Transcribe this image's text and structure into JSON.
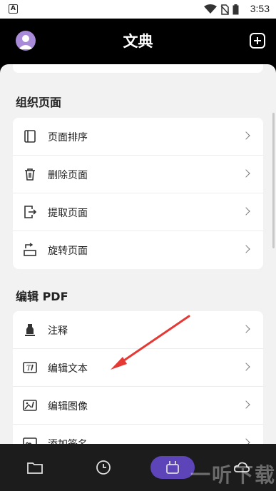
{
  "status_bar": {
    "time": "3:53",
    "notification_icon_letter": "A"
  },
  "header": {
    "title": "文典"
  },
  "sections": [
    {
      "title": "组织页面",
      "items": [
        {
          "label": "页面排序",
          "icon": "page-order-icon"
        },
        {
          "label": "删除页面",
          "icon": "trash-icon"
        },
        {
          "label": "提取页面",
          "icon": "extract-page-icon"
        },
        {
          "label": "旋转页面",
          "icon": "rotate-page-icon"
        }
      ]
    },
    {
      "title": "编辑 PDF",
      "items": [
        {
          "label": "注释",
          "icon": "highlighter-icon"
        },
        {
          "label": "编辑文本",
          "icon": "edit-text-icon"
        },
        {
          "label": "编辑图像",
          "icon": "edit-image-icon"
        },
        {
          "label": "添加签名",
          "icon": "signature-icon"
        }
      ]
    }
  ],
  "bottom_nav": {
    "items": [
      "folder-icon",
      "history-icon",
      "tools-icon",
      "cloud-icon"
    ],
    "active": "tools-icon"
  },
  "watermark": "一听下载",
  "colors": {
    "accent": "#5d44b8",
    "annotation_arrow": "#e53935",
    "avatar": "#a98ad8"
  }
}
